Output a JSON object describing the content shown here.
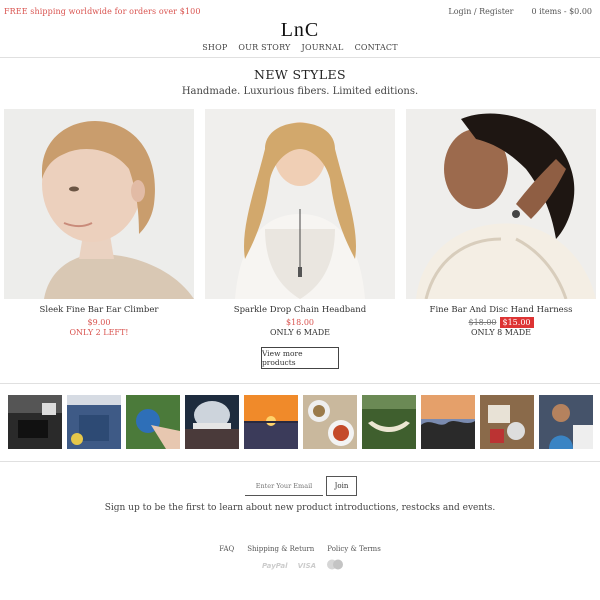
{
  "topbar": {
    "promo": "FREE shipping worldwide for orders over $100",
    "login": "Login / Register",
    "cart": "0 items - $0.00"
  },
  "logo": "LnC",
  "nav": [
    "SHOP",
    "OUR STORY",
    "JOURNAL",
    "CONTACT"
  ],
  "section": {
    "title": "NEW STYLES",
    "subtitle": "Handmade. Luxurious fibers. Limited editions."
  },
  "products": [
    {
      "name": "Sleek Fine Bar Ear Climber",
      "price": "$9.00",
      "stock": "ONLY 2 LEFT!"
    },
    {
      "name": "Sparkle Drop Chain Headband",
      "price": "$18.00",
      "stock": "ONLY 6 MADE"
    },
    {
      "name": "Fine Bar And Disc Hand Harness",
      "price_original": "$18.00",
      "price_sale": "$15.00",
      "stock": "ONLY 8 MADE"
    }
  ],
  "view_more": "View more products",
  "newsletter": {
    "placeholder": "Enter Your Email",
    "join": "Join",
    "text": "Sign up to be the first to learn about new product introductions, restocks and events."
  },
  "footer": {
    "links": [
      "FAQ",
      "Shipping & Return",
      "Policy & Terms"
    ],
    "payments": [
      "PayPal",
      "VISA",
      "mastercard"
    ]
  },
  "colors": {
    "accent": "#d9534f",
    "sale": "#dd3333"
  }
}
